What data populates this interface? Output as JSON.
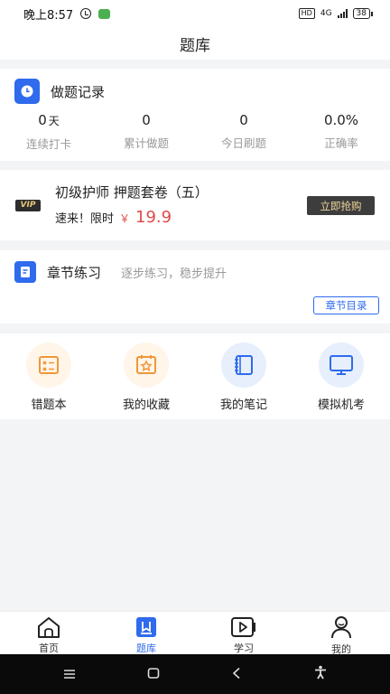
{
  "status_bar": {
    "time": "晚上8:57",
    "hd": "HD",
    "network": "4G",
    "battery": "38"
  },
  "header": {
    "title": "题库"
  },
  "record": {
    "title": "做题记录",
    "stats": [
      {
        "value": "0",
        "unit": "天",
        "label": "连续打卡"
      },
      {
        "value": "0",
        "unit": "",
        "label": "累计做题"
      },
      {
        "value": "0",
        "unit": "",
        "label": "今日刷题"
      },
      {
        "value": "0.0%",
        "unit": "",
        "label": "正确率"
      }
    ]
  },
  "vip": {
    "badge": "VIP",
    "title": "初级护师 押题套卷（五）",
    "promo": "速来！限时",
    "currency": "￥",
    "price": "19.9",
    "button": "立即抢购"
  },
  "chapter": {
    "title": "章节练习",
    "desc": "逐步练习，稳步提升",
    "button": "章节目录"
  },
  "quick_actions": [
    {
      "label": "错题本",
      "icon": "wrong-book-icon",
      "color": "#f0973a"
    },
    {
      "label": "我的收藏",
      "icon": "favorites-icon",
      "color": "#f0973a"
    },
    {
      "label": "我的笔记",
      "icon": "notebook-icon",
      "color": "#2f6bec"
    },
    {
      "label": "模拟机考",
      "icon": "monitor-icon",
      "color": "#2f6bec"
    }
  ],
  "tabbar": [
    {
      "label": "首页",
      "icon": "home-icon"
    },
    {
      "label": "题库",
      "icon": "question-bank-icon"
    },
    {
      "label": "学习",
      "icon": "video-play-icon"
    },
    {
      "label": "我的",
      "icon": "profile-icon"
    }
  ],
  "colors": {
    "accent": "#2f6bec",
    "price": "#e24a4a",
    "orange": "#f0973a"
  }
}
